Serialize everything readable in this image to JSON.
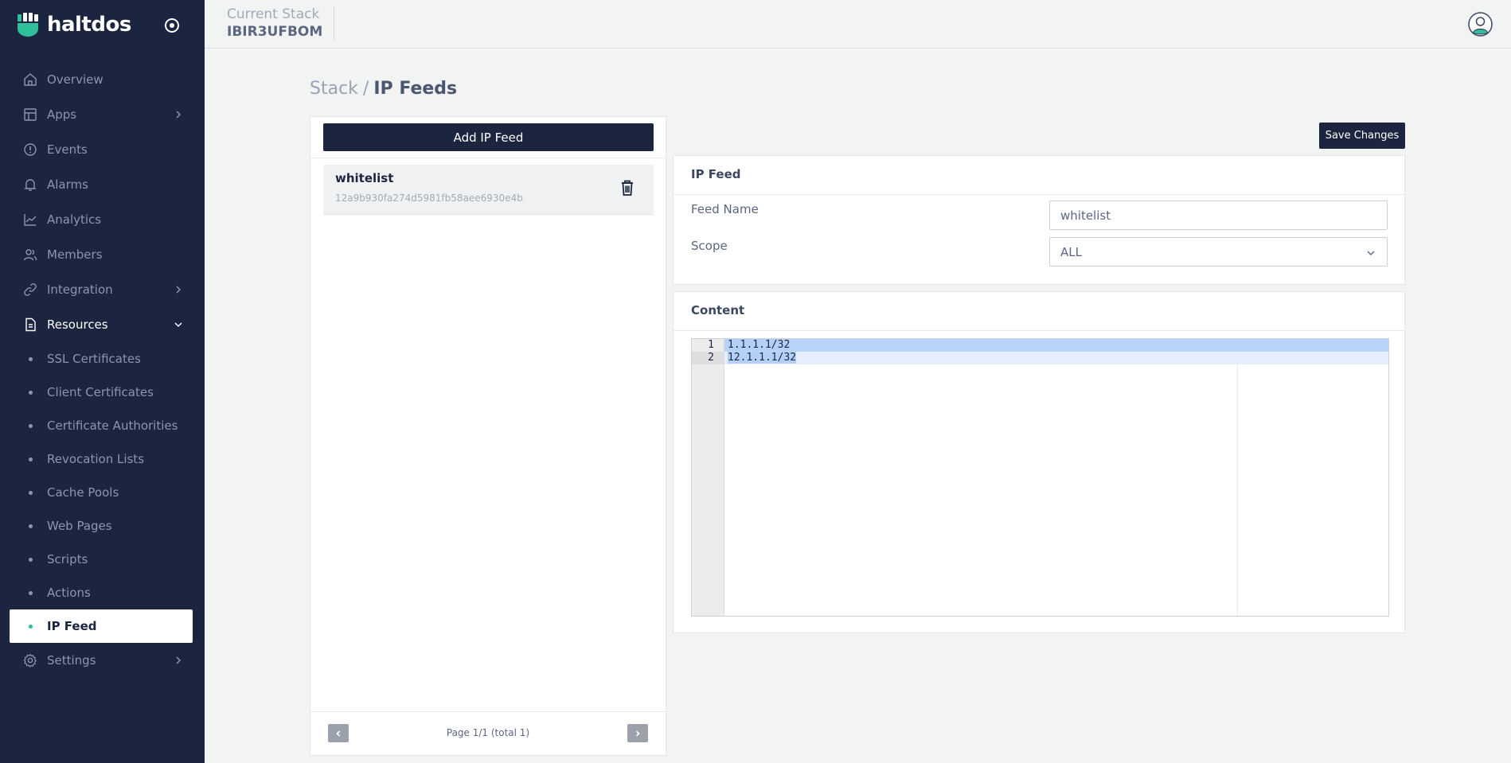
{
  "brand": {
    "name": "haltdos"
  },
  "header": {
    "stack_caption": "Current Stack",
    "stack_name": "IBIR3UFBOM"
  },
  "sidebar": {
    "items": [
      {
        "label": "Overview",
        "icon": "home-icon"
      },
      {
        "label": "Apps",
        "icon": "layout-icon",
        "has_children": true
      },
      {
        "label": "Events",
        "icon": "alert-circle-icon"
      },
      {
        "label": "Alarms",
        "icon": "bell-icon"
      },
      {
        "label": "Analytics",
        "icon": "chart-line-icon"
      },
      {
        "label": "Members",
        "icon": "users-icon"
      },
      {
        "label": "Integration",
        "icon": "link-icon",
        "has_children": true
      },
      {
        "label": "Resources",
        "icon": "file-icon",
        "expanded": true
      }
    ],
    "resources": [
      "SSL Certificates",
      "Client Certificates",
      "Certificate Authorities",
      "Revocation Lists",
      "Cache Pools",
      "Web Pages",
      "Scripts",
      "Actions",
      "IP Feed"
    ],
    "active_resource": "IP Feed",
    "settings": {
      "label": "Settings",
      "icon": "gear-icon"
    }
  },
  "breadcrumb": {
    "parent": "Stack",
    "separator": "/",
    "current": "IP Feeds"
  },
  "list": {
    "add_label": "Add IP Feed",
    "items": [
      {
        "name": "whitelist",
        "id": "12a9b930fa274d5981fb58aee6930e4b"
      }
    ],
    "pagination": "Page 1/1 (total 1)"
  },
  "editor": {
    "save_label": "Save Changes",
    "feed_card_title": "IP Feed",
    "feed_name_label": "Feed Name",
    "feed_name_value": "whitelist",
    "scope_label": "Scope",
    "scope_value": "ALL",
    "content_title": "Content",
    "content_lines": [
      "1.1.1.1/32",
      "12.1.1.1/32"
    ],
    "line_numbers": [
      "1",
      "2"
    ]
  },
  "colors": {
    "sidebar_bg": "#1b2540",
    "accent": "#2fbf9b",
    "primary_button": "#1b2540",
    "selection": "#b9d4fa"
  }
}
